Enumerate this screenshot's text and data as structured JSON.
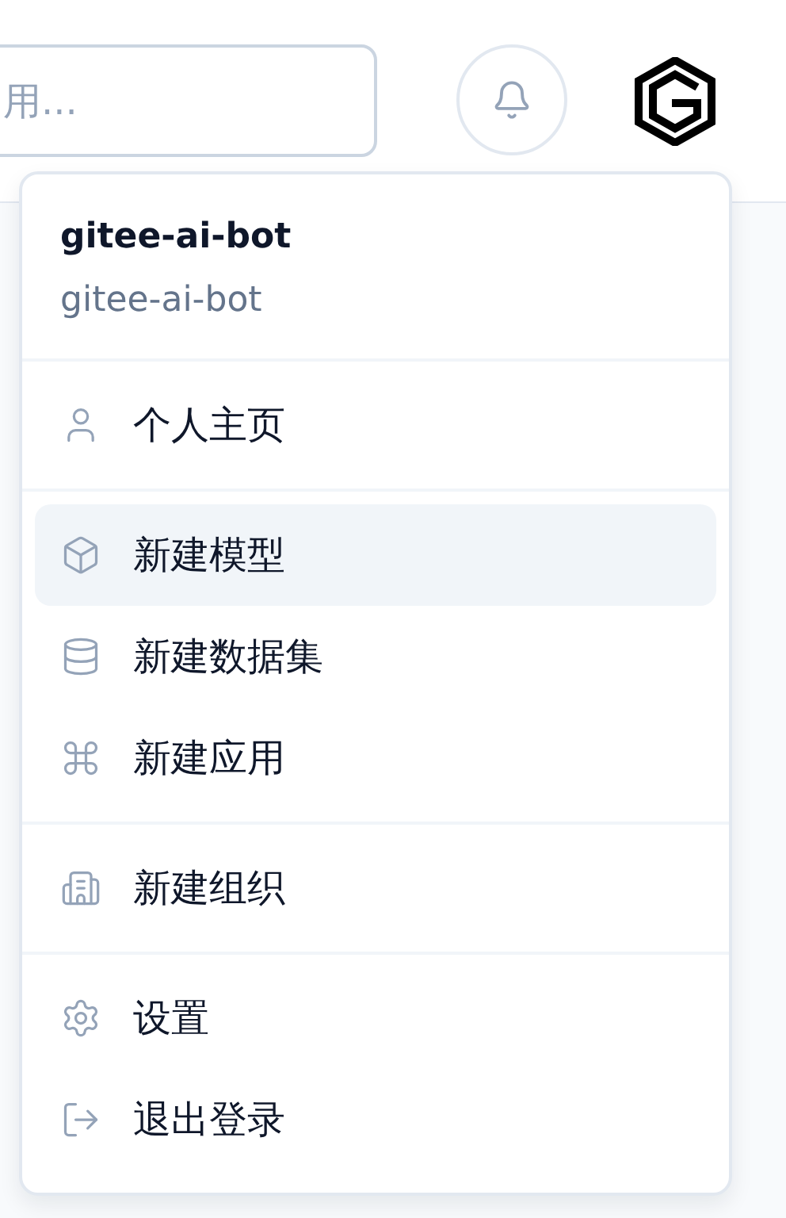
{
  "header": {
    "search": {
      "placeholder": "用..."
    }
  },
  "user_menu": {
    "username": "gitee-ai-bot",
    "handle": "gitee-ai-bot",
    "sections": [
      {
        "items": [
          {
            "label": "个人主页",
            "kind": "user",
            "selected": false
          }
        ]
      },
      {
        "items": [
          {
            "label": "新建模型",
            "kind": "box",
            "selected": true
          },
          {
            "label": "新建数据集",
            "kind": "database",
            "selected": false
          },
          {
            "label": "新建应用",
            "kind": "apps",
            "selected": false
          }
        ]
      },
      {
        "items": [
          {
            "label": "新建组织",
            "kind": "building",
            "selected": false
          }
        ]
      },
      {
        "items": [
          {
            "label": "设置",
            "kind": "settings",
            "selected": false
          },
          {
            "label": "退出登录",
            "kind": "logout",
            "selected": false
          }
        ]
      }
    ]
  }
}
